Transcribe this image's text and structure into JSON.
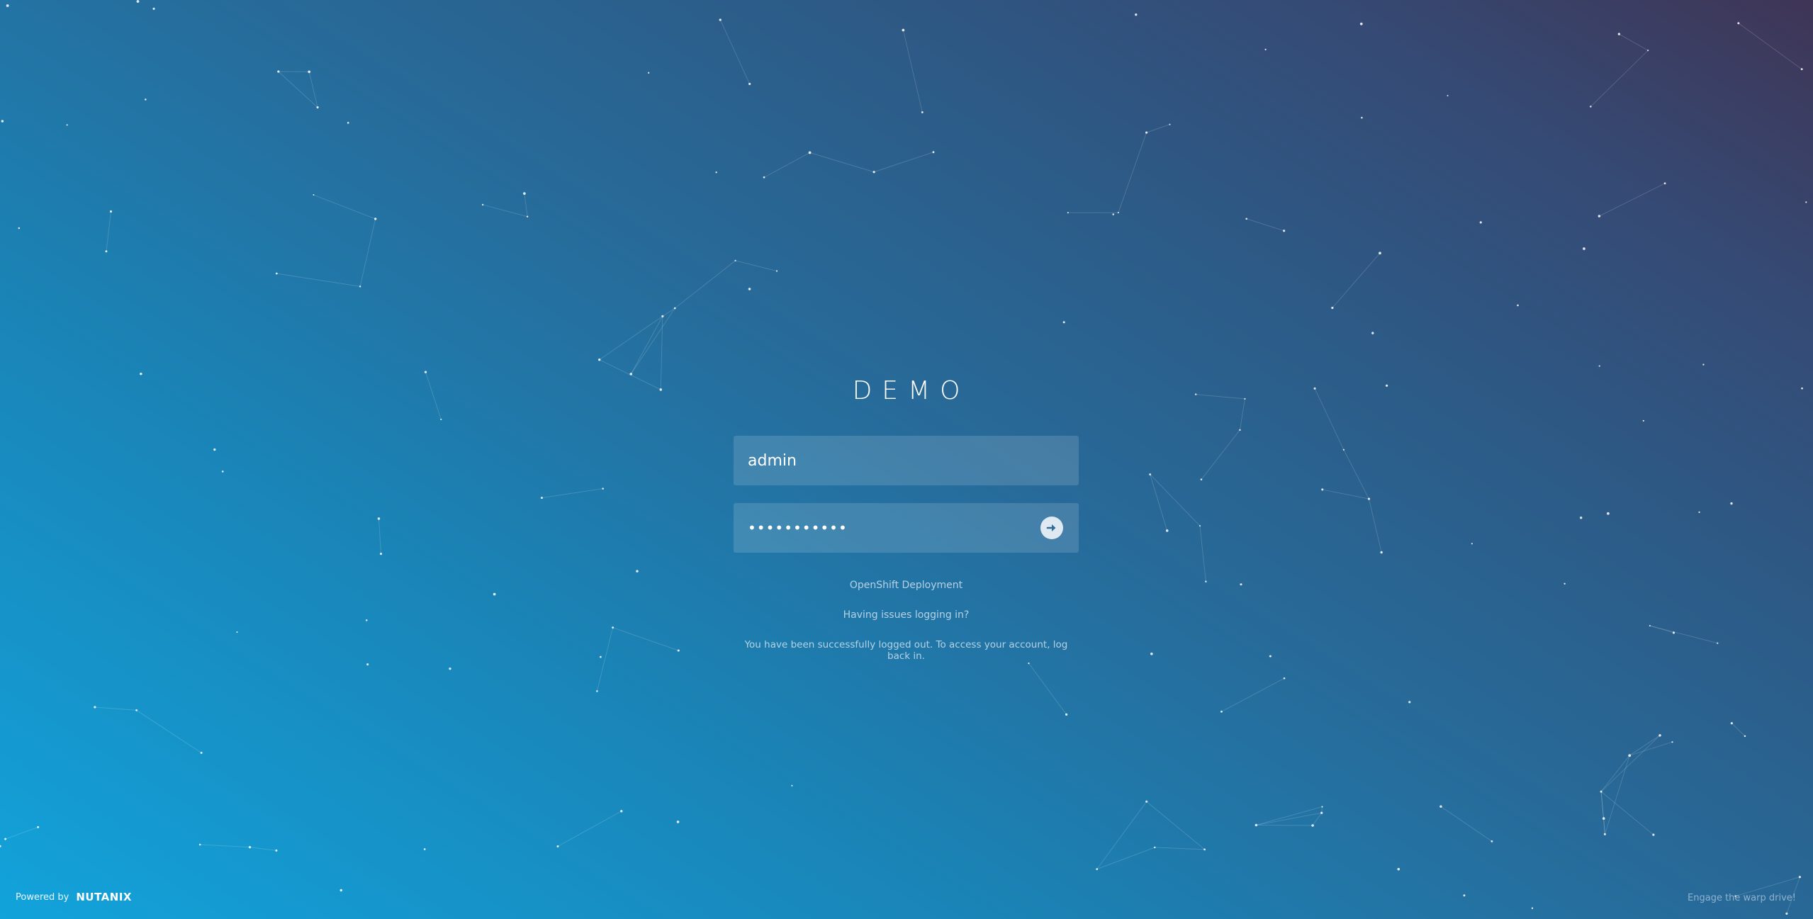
{
  "app_title": "DEMO",
  "login": {
    "username_value": "admin",
    "password_value": "•••••••••••",
    "submit_icon": "arrow-right-icon"
  },
  "links": {
    "deployment": "OpenShift Deployment",
    "help": "Having issues logging in?",
    "status_message": "You have been successfully logged out. To access your account, log back in."
  },
  "footer": {
    "powered_by": "Powered by",
    "brand": "NUTANIX",
    "tagline": "Engage the warp drive!"
  },
  "colors": {
    "gradient_start": "#12a3db",
    "gradient_end": "#3f3556",
    "field_bg": "rgba(255,255,255,0.14)",
    "submit_button": "#dfe9f1"
  }
}
